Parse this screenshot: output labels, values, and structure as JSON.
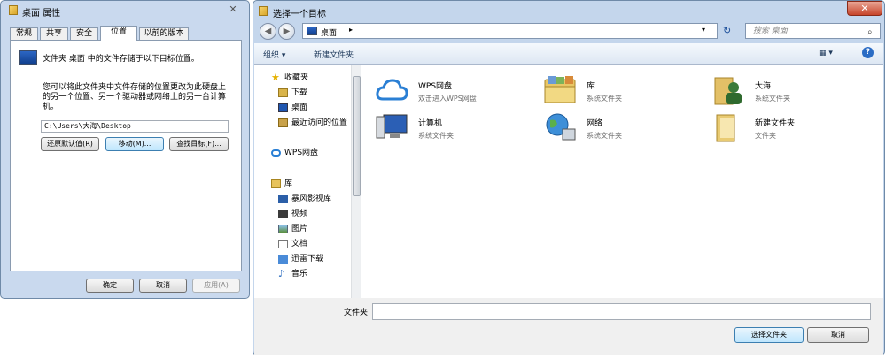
{
  "props_dialog": {
    "title": "桌面 属性",
    "close_glyph": "✕",
    "tabs": [
      "常规",
      "共享",
      "安全",
      "位置",
      "以前的版本"
    ],
    "active_tab": "位置",
    "desc1": "文件夹 桌面 中的文件存储于以下目标位置。",
    "desc2": "您可以将此文件夹中文件存储的位置更改为此硬盘上的另一个位置、另一个驱动器或网络上的另一台计算机。",
    "path": "C:\\Users\\大海\\Desktop",
    "buttons": {
      "restore": "还原默认值(R)",
      "move": "移动(M)...",
      "find": "查找目标(F)..."
    },
    "footer": {
      "ok": "确定",
      "cancel": "取消",
      "apply": "应用(A)"
    }
  },
  "picker_dialog": {
    "title": "选择一个目标",
    "close_glyph": "✕",
    "back_glyph": "◀",
    "forward_glyph": "▶",
    "address": {
      "crumb": "桌面",
      "arrow": "▸",
      "dropdown": "▾"
    },
    "refresh_glyph": "↻",
    "search_placeholder": "搜索 桌面",
    "search_glyph": "⌕",
    "toolbar": {
      "organize": "组织 ▾",
      "new_folder": "新建文件夹",
      "view_glyph": "▦ ▾",
      "help_glyph": "?"
    },
    "nav": {
      "favorites_header": "收藏夹",
      "favorites": [
        "下载",
        "桌面",
        "最近访问的位置"
      ],
      "wps": "WPS网盘",
      "library_header": "库",
      "library": [
        "暴风影视库",
        "视频",
        "图片",
        "文档",
        "迅雷下载",
        "音乐"
      ]
    },
    "items": [
      {
        "name": "WPS网盘",
        "sub": "双击进入WPS网盘",
        "icon": "cloud-icon"
      },
      {
        "name": "库",
        "sub": "系统文件夹",
        "icon": "library-icon"
      },
      {
        "name": "大海",
        "sub": "系统文件夹",
        "icon": "user-folder-icon"
      },
      {
        "name": "计算机",
        "sub": "系统文件夹",
        "icon": "computer-icon"
      },
      {
        "name": "网络",
        "sub": "系统文件夹",
        "icon": "network-icon"
      },
      {
        "name": "新建文件夹",
        "sub": "文件夹",
        "icon": "folder-icon"
      }
    ],
    "filename_label": "文件夹:",
    "filename_value": "",
    "buttons": {
      "select": "选择文件夹",
      "cancel": "取消"
    }
  },
  "colors": {
    "frame": "#c4d6ec",
    "close_red": "#c7452a",
    "accent_blue": "#3c7fb1"
  }
}
